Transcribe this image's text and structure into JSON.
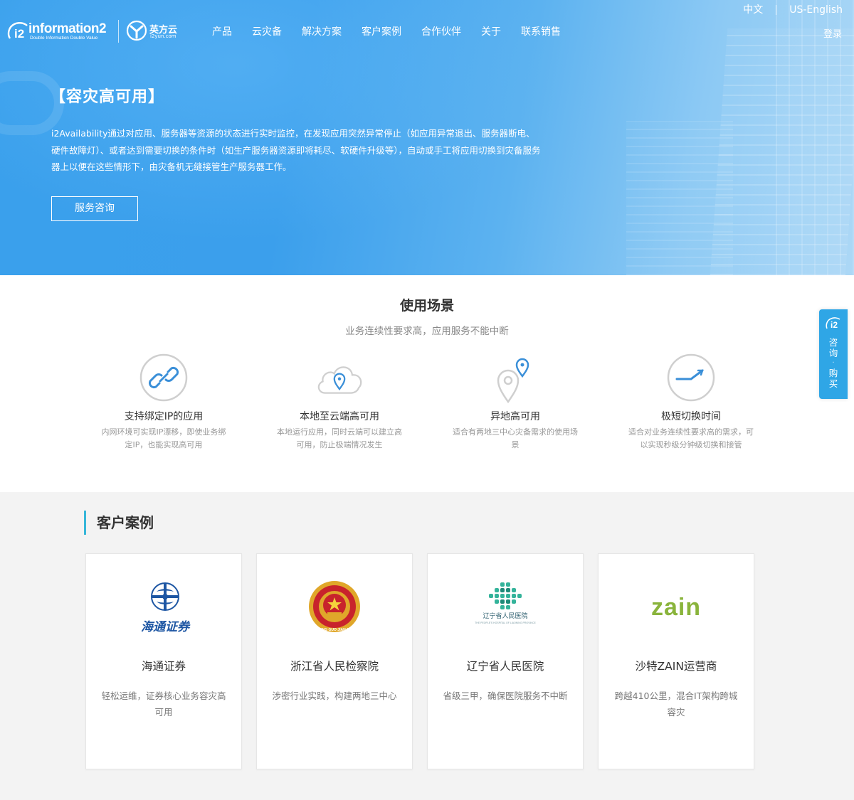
{
  "header": {
    "logo_i2_text": "information2",
    "logo_i2_tagline": "Double Information Double Value",
    "logo_yun_cn": "英方云",
    "logo_yun_en": "i2yun.com",
    "nav": [
      "产品",
      "云灾备",
      "解决方案",
      "客户案例",
      "合作伙伴",
      "关于",
      "联系销售"
    ],
    "lang_cn": "中文",
    "lang_en": "US-English",
    "login": "登录"
  },
  "hero": {
    "title": "【容灾高可用】",
    "description": "i2Availability通过对应用、服务器等资源的状态进行实时监控，在发现应用突然异常停止（如应用异常退出、服务器断电、硬件故障灯）、或者达到需要切换的条件时（如生产服务器资源即将耗尽、软硬件升级等），自动或手工将应用切换到灾备服务器上以便在这些情形下，由灾备机无缝接管生产服务器工作。",
    "button": "服务咨询"
  },
  "scenarios": {
    "title": "使用场景",
    "subtitle": "业务连续性要求高，应用服务不能中断",
    "items": [
      {
        "name": "支持绑定IP的应用",
        "desc": "内网环境可实现IP漂移，即使业务绑定IP，也能实现高可用",
        "icon": "link-icon"
      },
      {
        "name": "本地至云端高可用",
        "desc": "本地运行应用，同时云端可以建立高可用，防止极端情况发生",
        "icon": "cloud-location-icon"
      },
      {
        "name": "异地高可用",
        "desc": "适合有两地三中心灾备需求的使用场景",
        "icon": "map-pin-icon"
      },
      {
        "name": "极短切换时间",
        "desc": "适合对业务连续性要求高的需求，可以实现秒级分钟级切换和接管",
        "icon": "gauge-icon"
      }
    ]
  },
  "cases": {
    "title": "客户案例",
    "items": [
      {
        "name": "海通证券",
        "desc": "轻松运维，证券核心业务容灾高可用",
        "logo_text": "海通证券"
      },
      {
        "name": "浙江省人民检察院",
        "desc": "涉密行业实践，构建两地三中心",
        "logo_text": "ZHONG GUO JIAN CHA"
      },
      {
        "name": "辽宁省人民医院",
        "desc": "省级三甲，确保医院服务不中断",
        "logo_text": "辽宁省人民医院",
        "logo_sub": "THE PEOPLE'S HOSPITAL OF LIAONING PROVINCE"
      },
      {
        "name": "沙特ZAIN运营商",
        "desc": "跨越410公里，混合IT架构跨城容灾",
        "logo_text": "zain"
      }
    ]
  },
  "float": {
    "lines": [
      "咨",
      "询",
      "·",
      "购",
      "买"
    ]
  },
  "colors": {
    "hero_blue": "#3aa0ec",
    "accent_cyan": "#36b6d9",
    "float_blue": "#2fa6e6",
    "zain_green": "#8ab43c"
  }
}
